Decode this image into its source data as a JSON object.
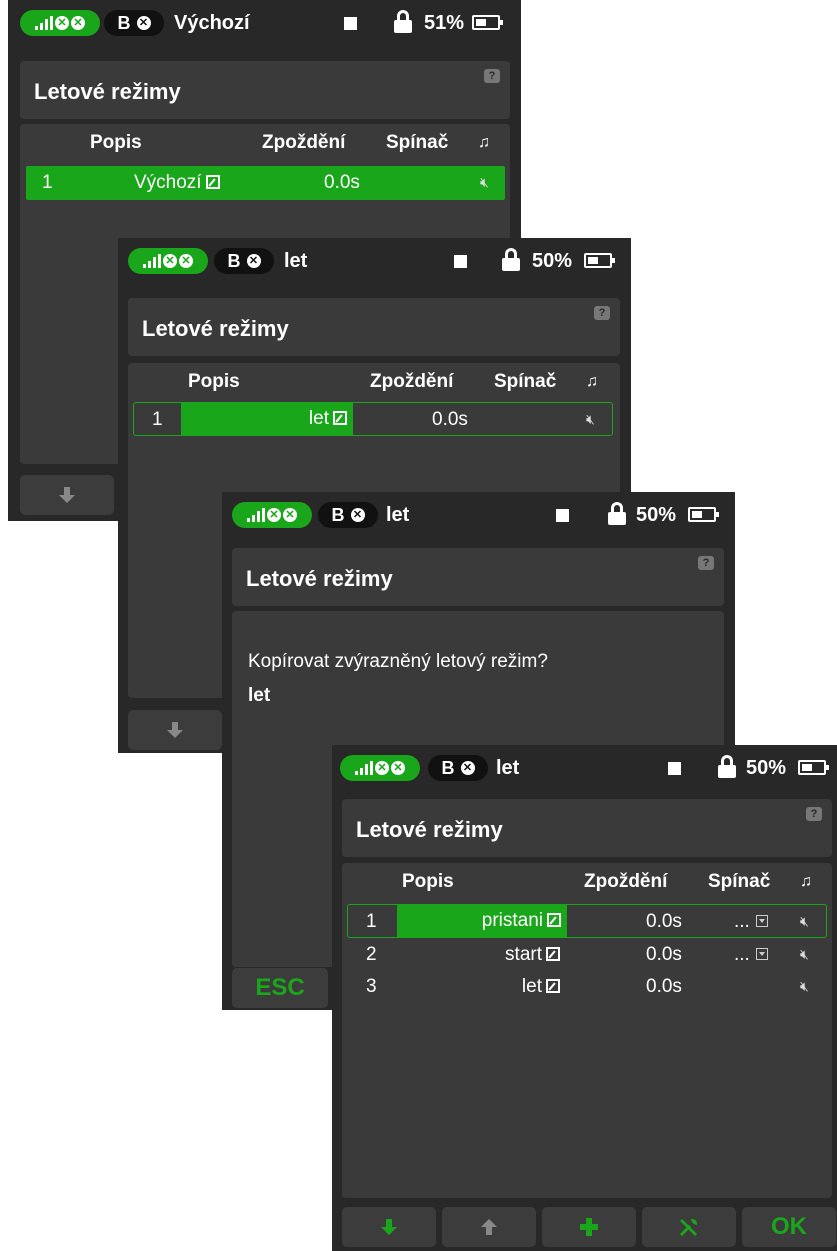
{
  "screens": [
    {
      "status": {
        "bars": ".ıll",
        "rx": "B",
        "model": "Výchozí",
        "battery": "51%",
        "battery_fill": 0.51
      },
      "title": "Letové režimy",
      "help": "?",
      "headers": {
        "description": "Popis",
        "delay": "Zpoždění",
        "switch": "Spínač",
        "sound": "♫"
      },
      "rows": [
        {
          "num": "1",
          "name": "Výchozí",
          "delay": "0.0s"
        }
      ]
    },
    {
      "status": {
        "bars": ".ıll",
        "rx": "B",
        "model": "let",
        "battery": "50%",
        "battery_fill": 0.5
      },
      "title": "Letové režimy",
      "help": "?",
      "headers": {
        "description": "Popis",
        "delay": "Zpoždění",
        "switch": "Spínač",
        "sound": "♫"
      },
      "rows": [
        {
          "num": "1",
          "name": "let",
          "delay": "0.0s"
        }
      ]
    },
    {
      "status": {
        "bars": ".ıll",
        "rx": "B",
        "model": "let",
        "battery": "50%",
        "battery_fill": 0.5
      },
      "title": "Letové režimy",
      "help": "?",
      "dialog": {
        "question": "Kopírovat zvýrazněný letový režim?",
        "mode": "let"
      },
      "buttons": {
        "esc": "ESC"
      }
    },
    {
      "status": {
        "bars": ".ıll",
        "rx": "B",
        "model": "let",
        "battery": "50%",
        "battery_fill": 0.5
      },
      "title": "Letové režimy",
      "help": "?",
      "headers": {
        "description": "Popis",
        "delay": "Zpoždění",
        "switch": "Spínač",
        "sound": "♫"
      },
      "rows": [
        {
          "num": "1",
          "name": "pristani",
          "delay": "0.0s",
          "switch": "..."
        },
        {
          "num": "2",
          "name": "start",
          "delay": "0.0s",
          "switch": "..."
        },
        {
          "num": "3",
          "name": "let",
          "delay": "0.0s",
          "switch": ""
        }
      ],
      "buttons": {
        "ok": "OK"
      }
    }
  ],
  "colors": {
    "accent": "#1aa61a",
    "background": "#282828",
    "panel": "#3a3a3a"
  }
}
